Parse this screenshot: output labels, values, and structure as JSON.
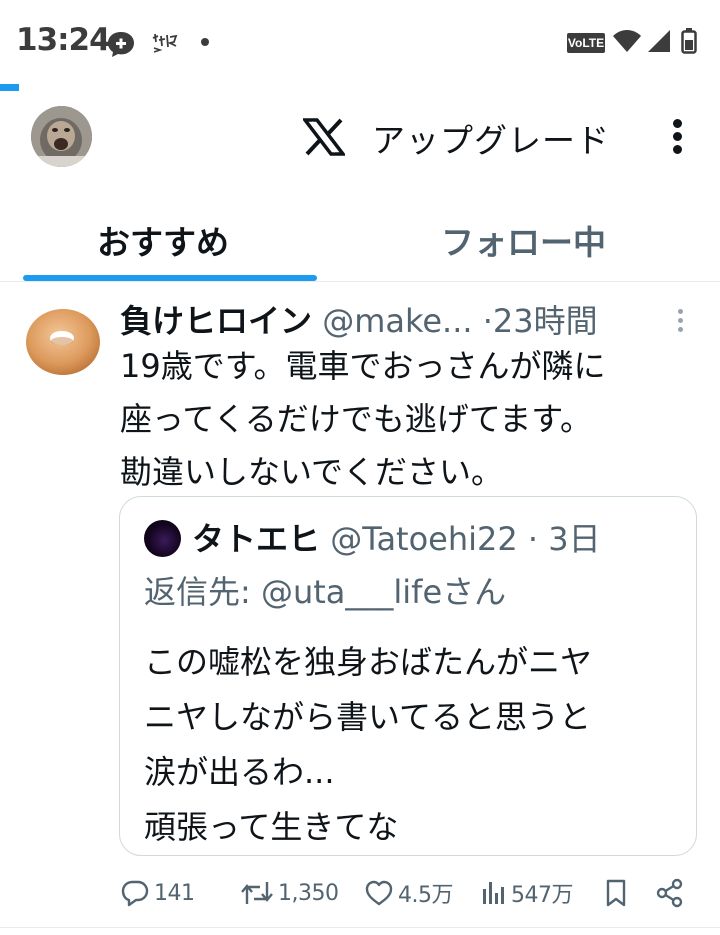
{
  "status_bar": {
    "time": "13:24",
    "icons": [
      "chat-bubble-plus-icon",
      "app-notification-icon",
      "more-notifications-dot-icon",
      "volte-icon",
      "wifi-icon",
      "cell-signal-icon",
      "battery-icon"
    ],
    "volte_label": "VoLTE"
  },
  "header": {
    "logo": "x-logo-icon",
    "upgrade_label": "アップグレード",
    "menu_icon": "more-vertical-icon"
  },
  "tabs": [
    {
      "label": "おすすめ",
      "active": true
    },
    {
      "label": "フォロー中",
      "active": false
    }
  ],
  "colors": {
    "accent": "#1d9bf0",
    "text_primary": "#0f1419",
    "text_secondary": "#536471",
    "border": "#cfd9de"
  },
  "post": {
    "author": "負けヒロイン",
    "handle": "@make...",
    "separator": "·",
    "age": "23時間",
    "text_lines": [
      "19歳です。電車でおっさんが隣に",
      "座ってくるだけでも逃げてます。",
      "勘違いしないでください。"
    ],
    "quote": {
      "author": "タトエヒ",
      "handle": "@Tatoehi22",
      "age_meta": "· 3日",
      "reply_to": "返信先: @uta___lifeさん",
      "text_lines": [
        "この嘘松を独身おばたんがニヤ",
        "ニヤしながら書いてると思うと",
        "涙が出るわ...",
        "頑張って生きてな"
      ]
    },
    "actions": {
      "replies": "141",
      "reposts": "1,350",
      "likes": "4.5万",
      "views": "547万"
    }
  }
}
